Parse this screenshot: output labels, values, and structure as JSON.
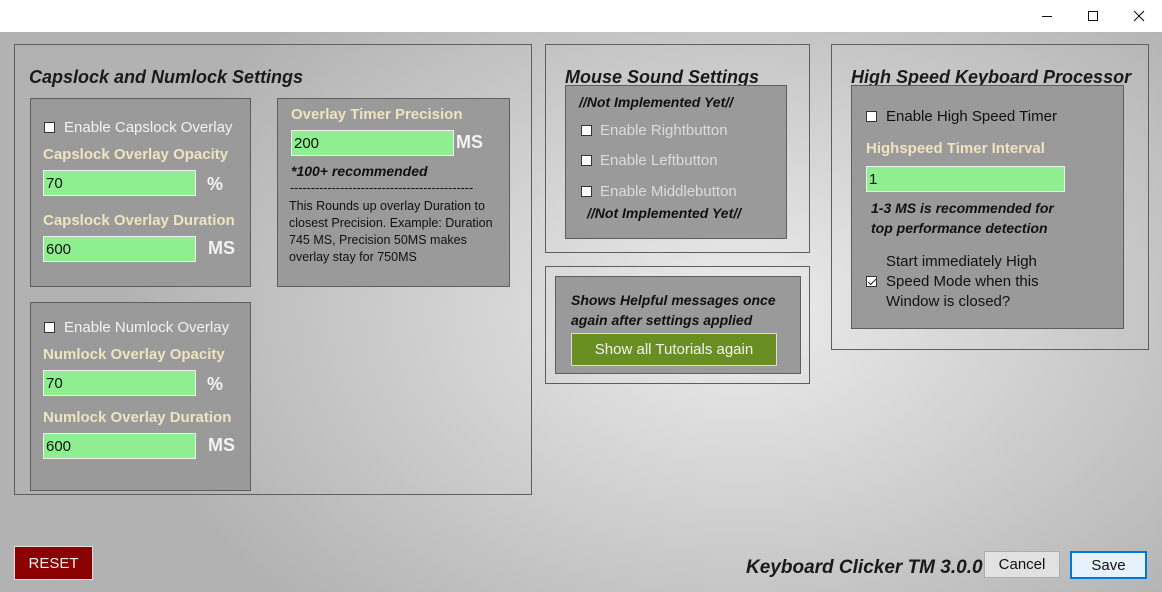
{
  "window_controls": {
    "minimize": "minimize",
    "maximize": "maximize",
    "close": "close"
  },
  "capslock_numlock": {
    "title": "Capslock and Numlock Settings",
    "capslock": {
      "enable_label": "Enable Capslock Overlay",
      "enabled": false,
      "opacity_label": "Capslock Overlay Opacity",
      "opacity_value": "70",
      "opacity_unit": "%",
      "duration_label": "Capslock Overlay Duration",
      "duration_value": "600",
      "duration_unit": "MS"
    },
    "numlock": {
      "enable_label": "Enable Numlock Overlay",
      "enabled": false,
      "opacity_label": "Numlock Overlay Opacity",
      "opacity_value": "70",
      "opacity_unit": "%",
      "duration_label": "Numlock Overlay Duration",
      "duration_value": "600",
      "duration_unit": "MS"
    },
    "timer": {
      "label": "Overlay Timer Precision",
      "value": "200",
      "unit": "MS",
      "recommend": "*100+ recommended",
      "divider": "--------------------------------------------",
      "desc": "This Rounds up overlay Duration to closest Precision. Example: Duration 745 MS, Precision 50MS makes overlay stay for 750MS"
    }
  },
  "mouse_sound": {
    "title": "Mouse Sound Settings",
    "notice_top": "//Not Implemented Yet//",
    "rightbutton_label": "Enable Rightbutton",
    "leftbutton_label": "Enable Leftbutton",
    "middlebutton_label": "Enable Middlebutton",
    "notice_bottom": "//Not Implemented Yet//"
  },
  "tutorials": {
    "message": "Shows Helpful messages once again after settings applied",
    "button_label": "Show all Tutorials again"
  },
  "high_speed": {
    "title": "High Speed Keyboard Processor",
    "enable_label": "Enable High Speed Timer",
    "enabled": false,
    "interval_label": "Highspeed Timer Interval",
    "interval_value": "1",
    "recommend": "1-3 MS is recommended for top performance detection",
    "start_label": "Start immediately High Speed Mode when this Window is closed?",
    "start_checked": true
  },
  "footer": {
    "reset_label": "RESET",
    "app_name": "Keyboard Clicker TM 3.0.0",
    "cancel_label": "Cancel",
    "save_label": "Save"
  },
  "colors": {
    "field_green": "#8fee8f",
    "reset_red": "#8b0000",
    "tutorial_green": "#6b8e23",
    "label_cream": "#f0e3c0"
  }
}
